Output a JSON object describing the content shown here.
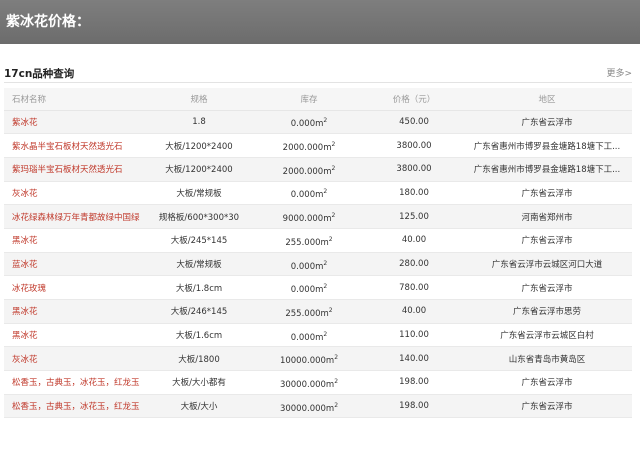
{
  "header": {
    "title": "紫冰花价格："
  },
  "section": {
    "title": "17cn品种查询",
    "more": "更多>"
  },
  "columns": [
    "石材名称",
    "规格",
    "库存",
    "价格（元）",
    "地区"
  ],
  "rows": [
    {
      "name": "紫冰花",
      "spec": "1.8",
      "stock": "0.000m",
      "price": "450.00",
      "region": "广东省云浮市"
    },
    {
      "name": "紫水晶半宝石板材天然透光石",
      "spec": "大板/1200*2400",
      "stock": "2000.000m",
      "price": "3800.00",
      "region": "广东省惠州市博罗县金塘路18塘下工..."
    },
    {
      "name": "紫玛瑙半宝石板材天然透光石",
      "spec": "大板/1200*2400",
      "stock": "2000.000m",
      "price": "3800.00",
      "region": "广东省惠州市博罗县金塘路18塘下工..."
    },
    {
      "name": "灰冰花",
      "spec": "大板/常规板",
      "stock": "0.000m",
      "price": "180.00",
      "region": "广东省云浮市"
    },
    {
      "name": "冰花绿森林绿万年青都故绿中国绿",
      "spec": "规格板/600*300*30",
      "stock": "9000.000m",
      "price": "125.00",
      "region": "河南省郑州市"
    },
    {
      "name": "黑冰花",
      "spec": "大板/245*145",
      "stock": "255.000m",
      "price": "40.00",
      "region": "广东省云浮市"
    },
    {
      "name": "蓝冰花",
      "spec": "大板/常规板",
      "stock": "0.000m",
      "price": "280.00",
      "region": "广东省云浮市云城区河口大道"
    },
    {
      "name": "冰花玫瑰",
      "spec": "大板/1.8cm",
      "stock": "0.000m",
      "price": "780.00",
      "region": "广东省云浮市"
    },
    {
      "name": "黑冰花",
      "spec": "大板/246*145",
      "stock": "255.000m",
      "price": "40.00",
      "region": "广东省云浮市思劳"
    },
    {
      "name": "黑冰花",
      "spec": "大板/1.6cm",
      "stock": "0.000m",
      "price": "110.00",
      "region": "广东省云浮市云城区白村"
    },
    {
      "name": "灰冰花",
      "spec": "大板/1800",
      "stock": "10000.000m",
      "price": "140.00",
      "region": "山东省青岛市黄岛区"
    },
    {
      "name": "松香玉，古典玉，冰花玉，红龙玉",
      "spec": "大板/大小都有",
      "stock": "30000.000m",
      "price": "198.00",
      "region": "广东省云浮市"
    },
    {
      "name": "松香玉，古典玉，冰花玉，红龙玉",
      "spec": "大板/大小",
      "stock": "30000.000m",
      "price": "198.00",
      "region": "广东省云浮市"
    }
  ],
  "stock_unit_exp": "2"
}
